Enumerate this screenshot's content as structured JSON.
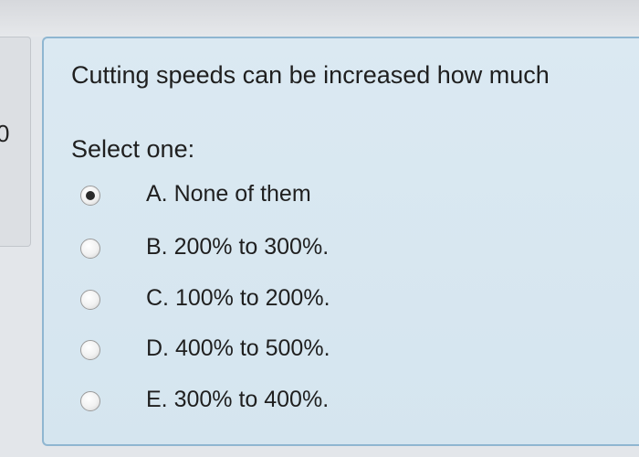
{
  "sidebar": {
    "partial_label": "0"
  },
  "question": {
    "text": "Cutting speeds can be increased how much",
    "prompt": "Select one:",
    "options": [
      {
        "label": "A. None of them",
        "selected": true
      },
      {
        "label": "B. 200% to 300%.",
        "selected": false
      },
      {
        "label": "C. 100% to 200%.",
        "selected": false
      },
      {
        "label": "D. 400% to 500%.",
        "selected": false
      },
      {
        "label": "E. 300% to 400%.",
        "selected": false
      }
    ]
  }
}
